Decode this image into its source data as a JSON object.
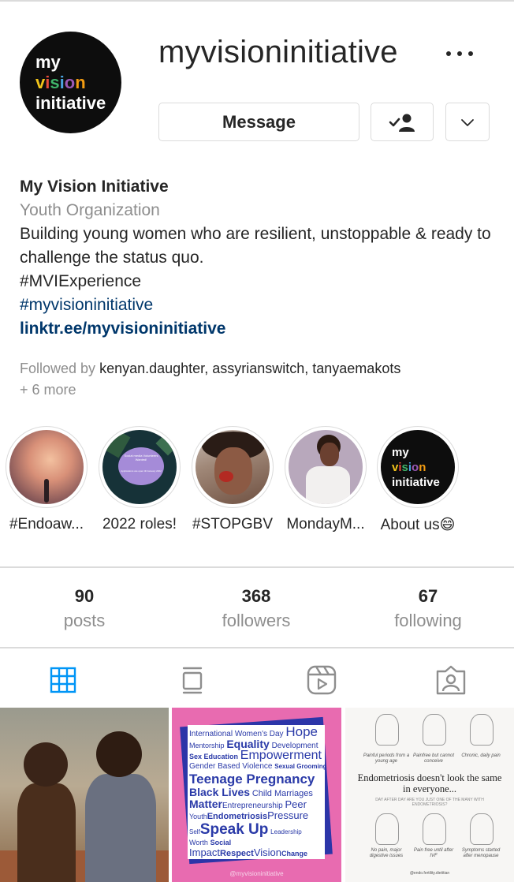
{
  "profile": {
    "username": "myvisioninitiative",
    "avatar_logo": {
      "line1": "my",
      "line2": "vision",
      "line3": "initiative"
    },
    "buttons": {
      "message": "Message",
      "follow_icon": "person-check-icon",
      "dropdown_icon": "chevron-down-icon",
      "more_icon": "more-horizontal-icon"
    }
  },
  "bio": {
    "name": "My Vision Initiative",
    "category": "Youth Organization",
    "text": "Building young women who are resilient, unstoppable & ready to challenge the status quo.",
    "tag1": "#MVIExperience",
    "tag2": "#myvisioninitiative",
    "link": "linktr.ee/myvisioninitiative"
  },
  "followed_by": {
    "prefix": "Followed by ",
    "user1": "kenyan.daughter",
    "sep1": ", ",
    "user2": "assyrianswitch",
    "sep2": ", ",
    "user3": "tanyaemakots",
    "more": "+ 6 more"
  },
  "highlights": [
    {
      "label": "#Endoaw..."
    },
    {
      "label": "2022 roles!",
      "cover_text": "Social media Volunteers Wanted!",
      "cover_text2": "Applications are open till January 2022"
    },
    {
      "label": "#STOPGBV"
    },
    {
      "label": "MondayM..."
    },
    {
      "label": "About us😄",
      "logo": {
        "line1": "my",
        "line2": "vision",
        "line3": "initiative"
      }
    }
  ],
  "stats": {
    "posts": {
      "value": "90",
      "label": "posts"
    },
    "followers": {
      "value": "368",
      "label": "followers"
    },
    "following": {
      "value": "67",
      "label": "following"
    }
  },
  "tabs": [
    {
      "name": "grid-icon",
      "active": true
    },
    {
      "name": "guide-icon"
    },
    {
      "name": "reels-icon"
    },
    {
      "name": "tagged-icon"
    }
  ],
  "posts": {
    "post2": {
      "words": [
        "International Women's Day",
        "Hope",
        "Mentorship",
        "Equality",
        "Development",
        "Sex Education",
        "Empowerment",
        "Gender Based Violence",
        "Sexual Grooming",
        "Teenage Pregnancy",
        "Black Lives",
        "Child Marriages",
        "Matter",
        "Entrepreneurship",
        "Peer",
        "Youth",
        "Endometriosis",
        "Pressure",
        "Self",
        "Speak Up",
        "Leadership",
        "Worth",
        "Social",
        "Impact",
        "Respect",
        "Vision",
        "Change"
      ],
      "footer": "@myvisioninitiative"
    },
    "post3": {
      "captions": [
        "Painful periods from a young age",
        "Painfree but cannot conceive",
        "Chronic, daily pain",
        "No pain, major digestive issues",
        "Pain free until after IVF",
        "Symptoms started after menopause"
      ],
      "headline": "Endometriosis doesn't look the same in everyone...",
      "subline": "DAY AFTER DAY ARE YOU JUST ONE OF THE MANY WITH ENDOMETRIOSIS?",
      "footer": "@endo.fertility.dietitian"
    }
  },
  "colors": {
    "link": "#00376b",
    "muted": "#8e8e8e",
    "text": "#262626",
    "active_tab": "#0095f6",
    "border": "#dbdbdb"
  }
}
